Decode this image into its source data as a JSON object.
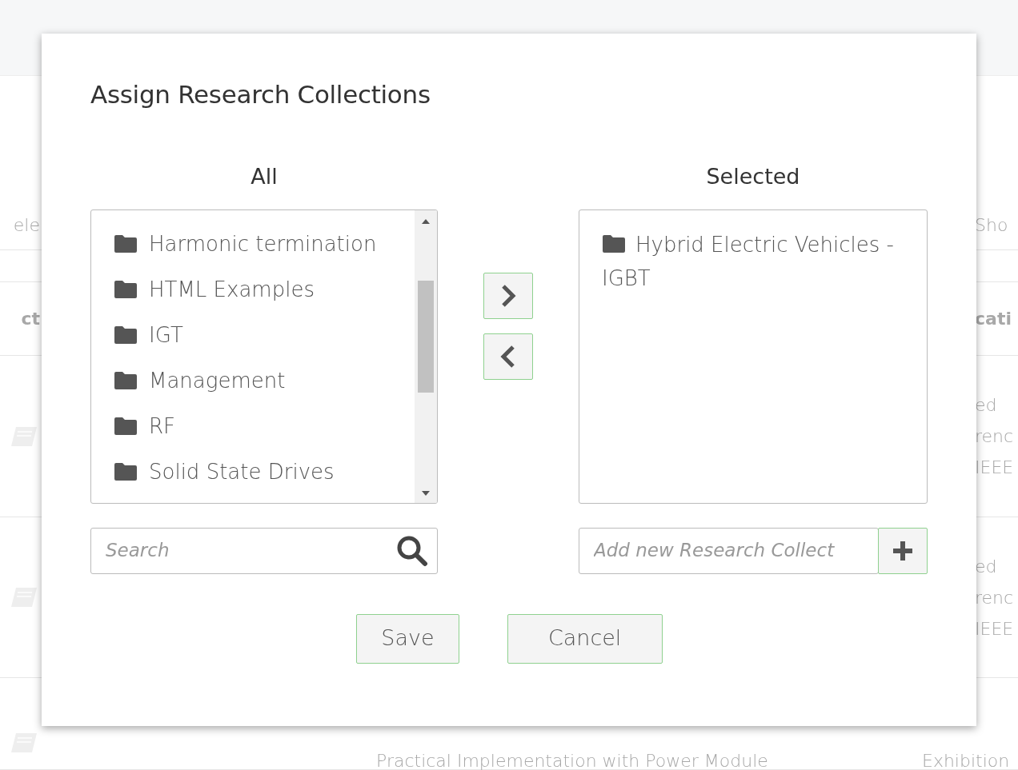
{
  "background": {
    "filter_row": {
      "left": "ele",
      "right": "Sho"
    },
    "header_row": {
      "left": "ct",
      "right": "cati"
    },
    "rows": [
      {
        "right_lines": [
          "ed",
          "renc",
          "IEEE"
        ]
      },
      {
        "right_lines": [
          "ed",
          "renc",
          "IEEE"
        ]
      },
      {
        "title_lines": [
          "Practical Implementation with Power Module"
        ],
        "right_lines": [
          "Exhibition"
        ]
      }
    ]
  },
  "dialog": {
    "title": "Assign Research Collections",
    "all": {
      "heading": "All",
      "items": [
        {
          "label": "Harmonic termination"
        },
        {
          "label": "HTML Examples"
        },
        {
          "label": "IGT"
        },
        {
          "label": "Management"
        },
        {
          "label": "RF"
        },
        {
          "label": "Solid State Drives"
        }
      ],
      "search": {
        "placeholder": "Search"
      }
    },
    "selected": {
      "heading": "Selected",
      "items": [
        {
          "label": "Hybrid Electric Vehicles - IGBT"
        }
      ],
      "new_field": {
        "placeholder": "Add new Research Collect"
      }
    },
    "buttons": [
      "Save",
      "Cancel"
    ]
  }
}
